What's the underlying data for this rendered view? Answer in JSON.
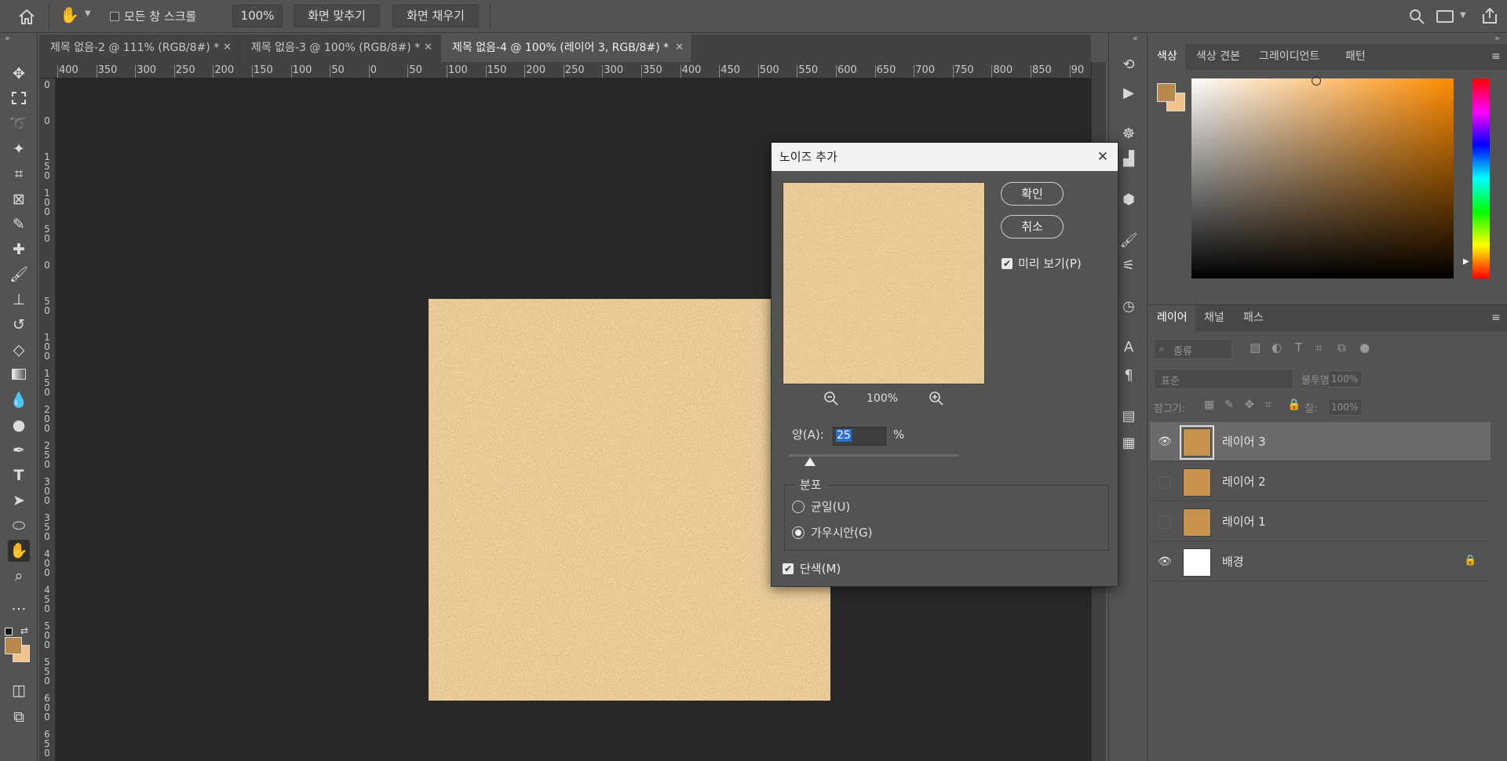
{
  "optbar": {
    "scroll_all_label": "모든 창 스크롤",
    "zoom_value": "100%",
    "fit_screen_label": "화면 맞추기",
    "fill_screen_label": "화면 채우기"
  },
  "tabs": [
    {
      "label": "제목 없음-2 @ 111% (RGB/8#) *"
    },
    {
      "label": "제목 없음-3 @ 100% (RGB/8#) *"
    },
    {
      "label": "제목 없음-4 @ 100% (레이어 3, RGB/8#) *"
    }
  ],
  "ruler": {
    "top": [
      "400",
      "350",
      "300",
      "250",
      "200",
      "150",
      "100",
      "50",
      "0",
      "50",
      "100",
      "150",
      "200",
      "250",
      "300",
      "350",
      "400",
      "450",
      "500",
      "550",
      "600",
      "650",
      "700",
      "750",
      "800",
      "850",
      "90"
    ],
    "left": [
      "0",
      "0",
      "1\n5\n0",
      "1\n0\n0",
      "5\n0",
      "0",
      "5\n0",
      "1\n0\n0",
      "1\n5\n0",
      "2\n0\n0",
      "2\n5\n0",
      "3\n0\n0",
      "3\n5\n0",
      "4\n0\n0",
      "4\n5\n0",
      "5\n0\n0",
      "5\n5\n0",
      "6\n0\n0",
      "6\n5\n0"
    ]
  },
  "dialog": {
    "title": "노이즈 추가",
    "ok_label": "확인",
    "cancel_label": "취소",
    "preview_label": "미리 보기(P)",
    "zoom_value": "100%",
    "amount_label": "양(A):",
    "amount_value": "25",
    "amount_unit": "%",
    "amount_fraction": 0.125,
    "distribution_label": "분포",
    "uniform_label": "균일(U)",
    "gaussian_label": "가우시안(G)",
    "mono_label": "단색(M)"
  },
  "color_panel": {
    "tabs": [
      "색상",
      "색상 견본",
      "그레이디언트",
      "패턴"
    ],
    "foreground": "#b8884a",
    "background": "#f2c489"
  },
  "layers_panel": {
    "tabs": [
      "레이어",
      "채널",
      "패스"
    ],
    "filter_placeholder": "종류",
    "blend_mode": "표준",
    "opacity_label": "불투명도:",
    "opacity_value": "100%",
    "lock_label": "잠그기:",
    "fill_label": "칠:",
    "fill_value": "100%",
    "layers": [
      {
        "name": "레이어 3",
        "visible": true,
        "selected": true
      },
      {
        "name": "레이어 2",
        "visible": false,
        "selected": false
      },
      {
        "name": "레이어 1",
        "visible": false,
        "selected": false
      },
      {
        "name": "배경",
        "visible": true,
        "selected": false,
        "locked": true
      }
    ]
  }
}
